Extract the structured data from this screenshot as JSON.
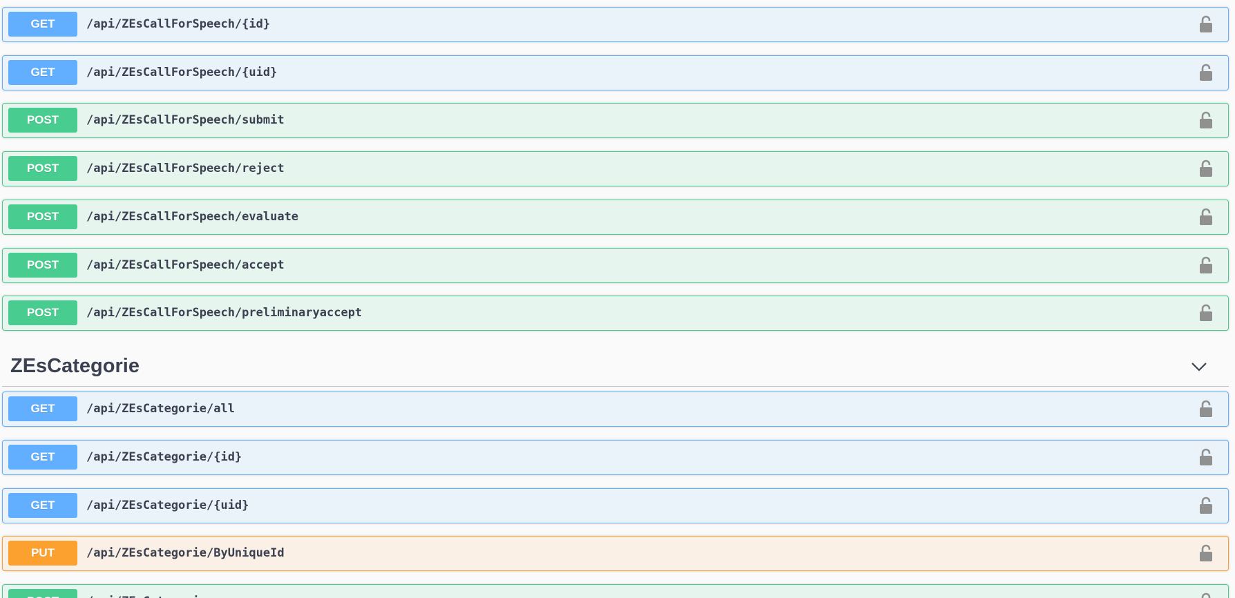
{
  "sections": [
    {
      "id": "callforspeech",
      "operations": [
        {
          "method": "GET",
          "path": "/api/ZEsCallForSpeech/{id}"
        },
        {
          "method": "GET",
          "path": "/api/ZEsCallForSpeech/{uid}"
        },
        {
          "method": "POST",
          "path": "/api/ZEsCallForSpeech/submit"
        },
        {
          "method": "POST",
          "path": "/api/ZEsCallForSpeech/reject"
        },
        {
          "method": "POST",
          "path": "/api/ZEsCallForSpeech/evaluate"
        },
        {
          "method": "POST",
          "path": "/api/ZEsCallForSpeech/accept"
        },
        {
          "method": "POST",
          "path": "/api/ZEsCallForSpeech/preliminaryaccept"
        }
      ]
    },
    {
      "id": "categorie",
      "tag_title": "ZEsCategorie",
      "expanded_icon": "chevron-down-icon",
      "operations": [
        {
          "method": "GET",
          "path": "/api/ZEsCategorie/all"
        },
        {
          "method": "GET",
          "path": "/api/ZEsCategorie/{id}"
        },
        {
          "method": "GET",
          "path": "/api/ZEsCategorie/{uid}"
        },
        {
          "method": "PUT",
          "path": "/api/ZEsCategorie/ByUniqueId"
        },
        {
          "method": "POST",
          "path": "/api/ZEsCategorie"
        }
      ]
    }
  ],
  "colors": {
    "get": "#61affe",
    "post": "#49cc90",
    "put": "#fca130",
    "text": "#3b4151",
    "lock": "#909090"
  },
  "icons": {
    "lock": "unlocked-padlock-icon"
  }
}
